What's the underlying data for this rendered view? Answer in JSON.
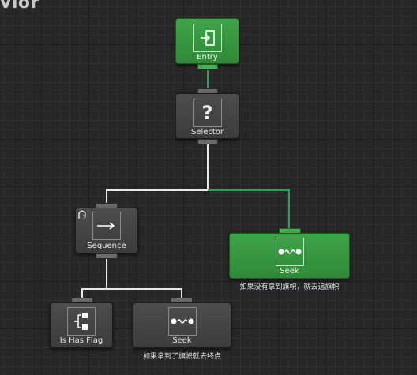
{
  "header": {
    "title": "vior"
  },
  "nodes": {
    "entry": {
      "label": "Entry"
    },
    "selector": {
      "label": "Selector",
      "icon_glyph": "?"
    },
    "sequence": {
      "label": "Sequence"
    },
    "seek_right": {
      "label": "Seek",
      "comment": "如果没有拿到旗帜，就去追旗帜"
    },
    "is_has_flag": {
      "label": "Is Has Flag"
    },
    "seek_left": {
      "label": "Seek",
      "comment": "如果拿到了旗帜就去终点"
    }
  },
  "colors": {
    "green_node": "#3a9b42",
    "gray_node": "#444444",
    "white_wire": "#e8e8e8",
    "green_wire": "#2fa05a"
  },
  "icons": [
    "entry-icon",
    "question-icon",
    "sequence-arrow-icon",
    "seek-icon",
    "conditional-icon",
    "conditional-abort-icon"
  ]
}
